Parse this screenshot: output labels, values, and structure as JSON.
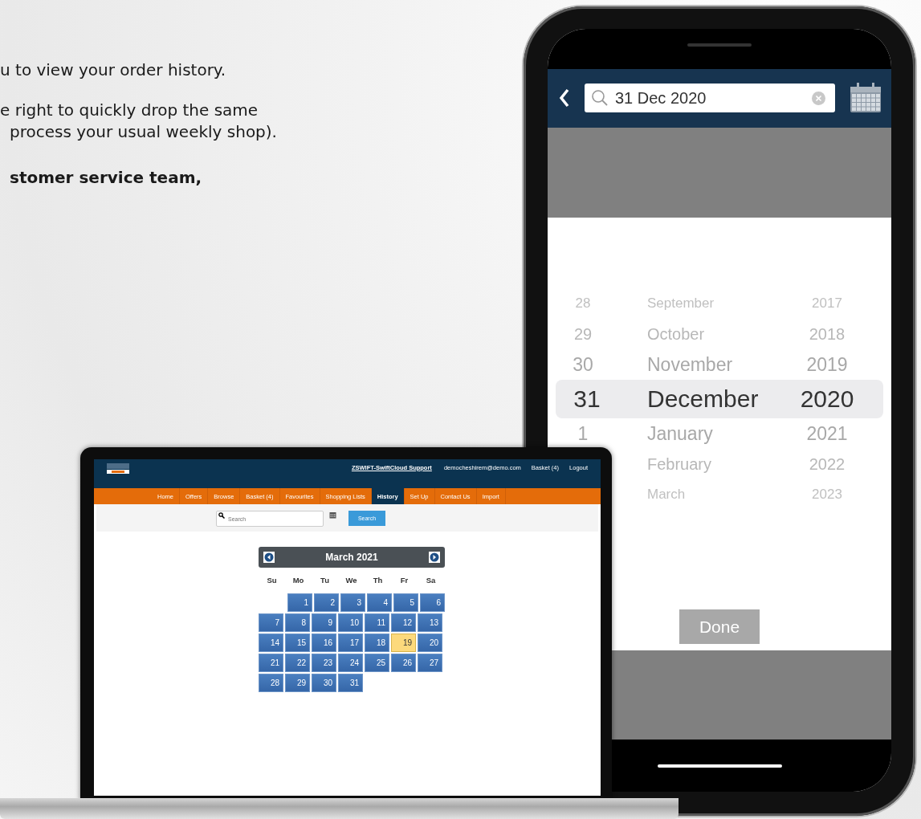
{
  "slide_text": [
    {
      "text": "u to view your order history.",
      "bold": false,
      "indent": false
    },
    {
      "text": "e right to quickly drop the same",
      "bold": false,
      "indent": false
    },
    {
      "text": "process your usual weekly shop).",
      "bold": false,
      "indent": true
    },
    {
      "text": "stomer service team,",
      "bold": true,
      "indent": true
    }
  ],
  "laptop": {
    "header_links": [
      {
        "label": "ZSWIFT-SwiftCloud Support",
        "kind": "support"
      },
      {
        "label": "democheshirem@demo.com",
        "kind": "plain"
      },
      {
        "label": "Basket (4)",
        "kind": "plain"
      },
      {
        "label": "Logout",
        "kind": "plain"
      }
    ],
    "nav_tabs": [
      {
        "label": "Home",
        "selected": false
      },
      {
        "label": "Offers",
        "selected": false
      },
      {
        "label": "Browse",
        "selected": false
      },
      {
        "label": "Basket (4)",
        "selected": false
      },
      {
        "label": "Favourites",
        "selected": false
      },
      {
        "label": "Shopping Lists",
        "selected": false
      },
      {
        "label": "History",
        "selected": true
      },
      {
        "label": "Set Up",
        "selected": false
      },
      {
        "label": "Contact Us",
        "selected": false
      },
      {
        "label": "Import",
        "selected": false
      }
    ],
    "search": {
      "placeholder": "Search",
      "button": "Search"
    },
    "calendar": {
      "month": "March 2021",
      "weekdays": [
        "Su",
        "Mo",
        "Tu",
        "We",
        "Th",
        "Fr",
        "Sa"
      ],
      "weeks": [
        [
          {
            "day": "1",
            "selected": false
          },
          {
            "day": "2",
            "selected": false
          },
          {
            "day": "3",
            "selected": false
          },
          {
            "day": "4",
            "selected": false
          },
          {
            "day": "5",
            "selected": false
          },
          {
            "day": "6",
            "selected": false
          }
        ],
        [
          {
            "day": "7",
            "selected": false
          },
          {
            "day": "8",
            "selected": false
          },
          {
            "day": "9",
            "selected": false
          },
          {
            "day": "10",
            "selected": false
          },
          {
            "day": "11",
            "selected": false
          },
          {
            "day": "12",
            "selected": false
          },
          {
            "day": "13",
            "selected": false
          }
        ],
        [
          {
            "day": "14",
            "selected": false
          },
          {
            "day": "15",
            "selected": false
          },
          {
            "day": "16",
            "selected": false
          },
          {
            "day": "17",
            "selected": false
          },
          {
            "day": "18",
            "selected": false
          },
          {
            "day": "19",
            "selected": true
          },
          {
            "day": "20",
            "selected": false
          }
        ],
        [
          {
            "day": "21",
            "selected": false
          },
          {
            "day": "22",
            "selected": false
          },
          {
            "day": "23",
            "selected": false
          },
          {
            "day": "24",
            "selected": false
          },
          {
            "day": "25",
            "selected": false
          },
          {
            "day": "26",
            "selected": false
          },
          {
            "day": "27",
            "selected": false
          }
        ],
        [
          {
            "day": "28",
            "selected": false
          },
          {
            "day": "29",
            "selected": false
          },
          {
            "day": "30",
            "selected": false
          },
          {
            "day": "31",
            "selected": false
          }
        ]
      ]
    }
  },
  "phone": {
    "search": {
      "value": "31 Dec 2020"
    },
    "picker_rows": [
      {
        "day": "28",
        "month": "September",
        "year": "2017",
        "selected": false
      },
      {
        "day": "29",
        "month": "October",
        "year": "2018",
        "selected": false
      },
      {
        "day": "30",
        "month": "November",
        "year": "2019",
        "selected": false
      },
      {
        "day": "31",
        "month": "December",
        "year": "2020",
        "selected": true
      },
      {
        "day": "1",
        "month": "January",
        "year": "2021",
        "selected": false
      },
      {
        "month": "February",
        "year": "2022",
        "selected": false
      },
      {
        "month": "March",
        "year": "2023",
        "selected": false
      }
    ],
    "done_button": "Done"
  }
}
